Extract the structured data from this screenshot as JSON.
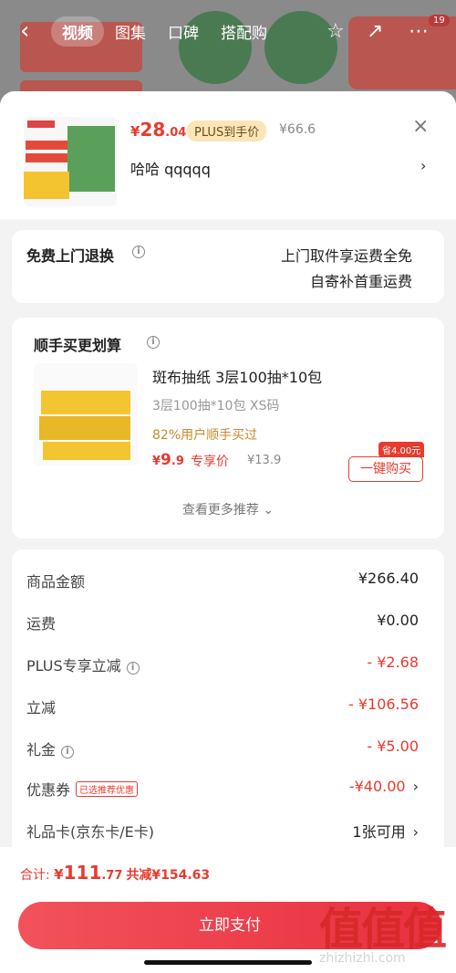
{
  "nav": {
    "tabs": [
      "视频",
      "图集",
      "口碑",
      "搭配购"
    ],
    "active_tab": 0,
    "badge": "19",
    "icons": [
      "back-icon",
      "star-icon",
      "share-icon",
      "more-icon"
    ]
  },
  "product": {
    "price_symbol": "¥",
    "price_int": "28",
    "price_dec": ".04",
    "plus_tag": "PLUS到手价",
    "original_price": "¥66.6",
    "spec": "哈哈 qqqqq",
    "spec_arrow": "›",
    "close": "×"
  },
  "return_service": {
    "title": "免费上门退换",
    "line1": "上门取件享运费全免",
    "line2": "自寄补首重运费"
  },
  "recommend": {
    "title": "顺手买更划算",
    "name": "斑布抽纸 3层100抽*10包",
    "spec": "3层100抽*10包 XS码",
    "stat": "82%用户顺手买过",
    "price_symbol": "¥",
    "price_int": "9",
    "price_dec": ".9",
    "exclusive": "专享价",
    "orig": "¥13.9",
    "save_tag": "省4.00元",
    "buy_label": "一键购买",
    "more": "查看更多推荐 ⌄"
  },
  "summary": [
    {
      "label": "商品金额",
      "value": "¥266.40",
      "red": false,
      "info": false,
      "tag": "",
      "chev": false
    },
    {
      "label": "运费",
      "value": "¥0.00",
      "red": false,
      "info": false,
      "tag": "",
      "chev": false
    },
    {
      "label": "PLUS专享立减",
      "value": "- ¥2.68",
      "red": true,
      "info": true,
      "tag": "",
      "chev": false
    },
    {
      "label": "立减",
      "value": "- ¥106.56",
      "red": true,
      "info": false,
      "tag": "",
      "chev": false
    },
    {
      "label": "礼金",
      "value": "- ¥5.00",
      "red": true,
      "info": true,
      "tag": "",
      "chev": false
    },
    {
      "label": "优惠券",
      "value": "-¥40.00",
      "red": true,
      "info": false,
      "tag": "已选推荐优惠",
      "chev": true
    },
    {
      "label": "礼品卡(京东卡/E卡)",
      "value": "1张可用",
      "red": false,
      "info": false,
      "tag": "",
      "chev": true
    }
  ],
  "footer": {
    "total_label": "合计: ",
    "total_symbol": "¥",
    "total_int": "111",
    "total_dec": ".77",
    "total_saved": "共减¥154.63",
    "pay_label": "立即支付"
  },
  "watermark": {
    "text": "值值值",
    "url": "zhizhizhi.com"
  },
  "colors": {
    "accent": "#e83a2e",
    "pay_button": "#ee3d4b",
    "plus_tag_bg": "#fbe6b8"
  }
}
